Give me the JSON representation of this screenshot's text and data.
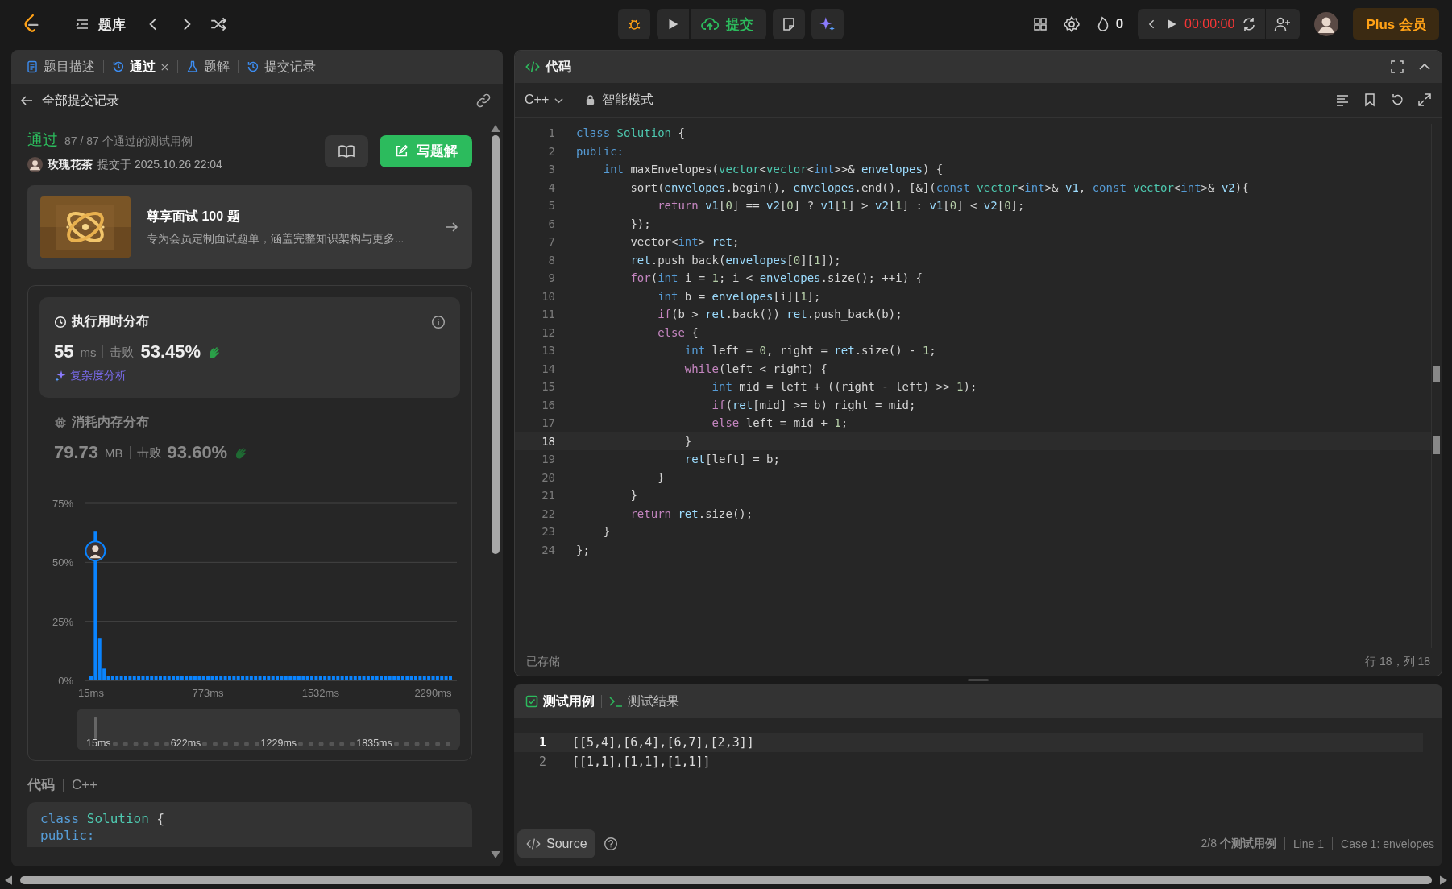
{
  "top_bar": {
    "problem_list": "题库",
    "submit": "提交",
    "streak": "0",
    "timer": "00:00:00",
    "plus": "Plus 会员"
  },
  "left_panel": {
    "tabs": [
      {
        "label": "题目描述",
        "kind": "description",
        "selected": false
      },
      {
        "label": "通过",
        "kind": "history",
        "selected": true,
        "closable": true
      },
      {
        "label": "题解",
        "kind": "solutions",
        "selected": false
      },
      {
        "label": "提交记录",
        "kind": "history",
        "selected": false
      }
    ],
    "back_label": "全部提交记录",
    "submission": {
      "status": "通过",
      "passed": "87 / 87 个通过的测试用例",
      "user": "玫瑰花茶",
      "submitted": "提交于 2025.10.26 22:04",
      "write_solution": "写题解"
    },
    "promo": {
      "title": "尊享面试 100 题",
      "subtitle": "专为会员定制面试题单，涵盖完整知识架构与更多..."
    },
    "runtime": {
      "title": "执行用时分布",
      "selected": true,
      "value": "55",
      "unit": "ms",
      "beats_label": "击败",
      "beats": "53.45%",
      "analysis": "复杂度分析"
    },
    "memory": {
      "title": "消耗内存分布",
      "selected": false,
      "value": "79.73",
      "unit": "MB",
      "beats_label": "击败",
      "beats": "93.60%"
    },
    "chart_data": {
      "type": "bar",
      "ylim": [
        0,
        75
      ],
      "yticks": [
        {
          "value": 0,
          "label": "0%"
        },
        {
          "value": 25,
          "label": "25%"
        },
        {
          "value": 50,
          "label": "50%"
        },
        {
          "value": 75,
          "label": "75%"
        }
      ],
      "categories": [
        "15ms",
        null,
        null,
        null,
        null,
        null,
        null,
        null,
        null,
        null,
        null,
        null,
        null,
        null,
        null,
        null,
        null,
        null,
        null,
        null,
        null,
        null,
        null,
        null,
        null,
        null,
        null,
        "773ms",
        null,
        null,
        null,
        null,
        null,
        null,
        null,
        null,
        null,
        null,
        null,
        null,
        null,
        null,
        null,
        null,
        null,
        null,
        null,
        null,
        null,
        null,
        null,
        null,
        null,
        "1532ms",
        null,
        null,
        null,
        null,
        null,
        null,
        null,
        null,
        null,
        null,
        null,
        null,
        null,
        null,
        null,
        null,
        null,
        null,
        null,
        null,
        null,
        null,
        null,
        null,
        null,
        "2290ms",
        null,
        null,
        null,
        null
      ],
      "series": [
        {
          "color": "#0a84ff",
          "values": [
            2,
            63,
            18,
            5,
            2,
            2,
            2,
            2,
            2,
            2,
            2,
            2,
            2,
            2,
            2,
            2,
            2,
            2,
            2,
            2,
            2,
            2,
            2,
            2,
            2,
            2,
            2,
            2,
            2,
            2,
            2,
            2,
            2,
            2,
            2,
            2,
            2,
            2,
            2,
            2,
            2,
            2,
            2,
            2,
            2,
            2,
            2,
            2,
            2,
            2,
            2,
            2,
            2,
            2,
            2,
            2,
            2,
            2,
            2,
            2,
            2,
            2,
            2,
            2,
            2,
            2,
            2,
            2,
            2,
            2,
            2,
            2,
            2,
            2,
            2,
            2,
            2,
            2,
            2,
            2,
            2,
            2,
            2,
            2
          ]
        }
      ]
    },
    "overview_labels": [
      "15ms",
      "622ms",
      "1229ms",
      "1835ms"
    ],
    "code_label": "代码",
    "code_language": "C++",
    "code_preview": [
      [
        {
          "text": "class",
          "kind": "keyword"
        },
        {
          "text": " Solution",
          "kind": "type"
        },
        {
          "text": " {",
          "kind": "plain"
        }
      ],
      [
        {
          "text": "public:",
          "kind": "keyword"
        }
      ]
    ]
  },
  "editor": {
    "title": "代码",
    "language": "C++",
    "mode": "智能模式",
    "saved": "已存储",
    "cursor": "行 18，列 18",
    "lines": [
      {
        "n": "1",
        "active": false,
        "tokens": [
          {
            "text": "class",
            "kind": "keyword"
          },
          {
            "text": " Solution",
            "kind": "type"
          },
          {
            "text": " {",
            "kind": "plain"
          }
        ]
      },
      {
        "n": "2",
        "active": false,
        "tokens": [
          {
            "text": "public:",
            "kind": "keyword"
          }
        ]
      },
      {
        "n": "3",
        "active": false,
        "tokens": [
          {
            "text": "    int",
            "kind": "keyword"
          },
          {
            "text": " maxEnvelopes(",
            "kind": "plain"
          },
          {
            "text": "vector",
            "kind": "type"
          },
          {
            "text": "<",
            "kind": "plain"
          },
          {
            "text": "vector",
            "kind": "type"
          },
          {
            "text": "<",
            "kind": "plain"
          },
          {
            "text": "int",
            "kind": "keyword"
          },
          {
            "text": ">>& ",
            "kind": "plain"
          },
          {
            "text": "envelopes",
            "kind": "variable"
          },
          {
            "text": ") {",
            "kind": "plain"
          }
        ]
      },
      {
        "n": "4",
        "active": false,
        "tokens": [
          {
            "text": "        sort(",
            "kind": "plain"
          },
          {
            "text": "envelopes",
            "kind": "variable"
          },
          {
            "text": ".begin(), ",
            "kind": "plain"
          },
          {
            "text": "envelopes",
            "kind": "variable"
          },
          {
            "text": ".end(), [&](",
            "kind": "plain"
          },
          {
            "text": "const",
            "kind": "keyword"
          },
          {
            "text": " vector",
            "kind": "type"
          },
          {
            "text": "<",
            "kind": "plain"
          },
          {
            "text": "int",
            "kind": "keyword"
          },
          {
            "text": ">& ",
            "kind": "plain"
          },
          {
            "text": "v1",
            "kind": "variable"
          },
          {
            "text": ", ",
            "kind": "plain"
          },
          {
            "text": "const",
            "kind": "keyword"
          },
          {
            "text": " vector",
            "kind": "type"
          },
          {
            "text": "<",
            "kind": "plain"
          },
          {
            "text": "int",
            "kind": "keyword"
          },
          {
            "text": ">& ",
            "kind": "plain"
          },
          {
            "text": "v2",
            "kind": "variable"
          },
          {
            "text": "){",
            "kind": "plain"
          }
        ]
      },
      {
        "n": "5",
        "active": false,
        "tokens": [
          {
            "text": "            return",
            "kind": "control"
          },
          {
            "text": " v1",
            "kind": "variable"
          },
          {
            "text": "[",
            "kind": "plain"
          },
          {
            "text": "0",
            "kind": "number"
          },
          {
            "text": "] == ",
            "kind": "plain"
          },
          {
            "text": "v2",
            "kind": "variable"
          },
          {
            "text": "[",
            "kind": "plain"
          },
          {
            "text": "0",
            "kind": "number"
          },
          {
            "text": "] ? ",
            "kind": "plain"
          },
          {
            "text": "v1",
            "kind": "variable"
          },
          {
            "text": "[",
            "kind": "plain"
          },
          {
            "text": "1",
            "kind": "number"
          },
          {
            "text": "] > ",
            "kind": "plain"
          },
          {
            "text": "v2",
            "kind": "variable"
          },
          {
            "text": "[",
            "kind": "plain"
          },
          {
            "text": "1",
            "kind": "number"
          },
          {
            "text": "] : ",
            "kind": "plain"
          },
          {
            "text": "v1",
            "kind": "variable"
          },
          {
            "text": "[",
            "kind": "plain"
          },
          {
            "text": "0",
            "kind": "number"
          },
          {
            "text": "] < ",
            "kind": "plain"
          },
          {
            "text": "v2",
            "kind": "variable"
          },
          {
            "text": "[",
            "kind": "plain"
          },
          {
            "text": "0",
            "kind": "number"
          },
          {
            "text": "];",
            "kind": "plain"
          }
        ]
      },
      {
        "n": "6",
        "active": false,
        "tokens": [
          {
            "text": "        });",
            "kind": "plain"
          }
        ]
      },
      {
        "n": "7",
        "active": false,
        "tokens": [
          {
            "text": "        vector<",
            "kind": "plain"
          },
          {
            "text": "int",
            "kind": "keyword"
          },
          {
            "text": "> ",
            "kind": "plain"
          },
          {
            "text": "ret",
            "kind": "variable"
          },
          {
            "text": ";",
            "kind": "plain"
          }
        ]
      },
      {
        "n": "8",
        "active": false,
        "tokens": [
          {
            "text": "        ret",
            "kind": "variable"
          },
          {
            "text": ".push_back(",
            "kind": "plain"
          },
          {
            "text": "envelopes",
            "kind": "variable"
          },
          {
            "text": "[",
            "kind": "plain"
          },
          {
            "text": "0",
            "kind": "number"
          },
          {
            "text": "][",
            "kind": "plain"
          },
          {
            "text": "1",
            "kind": "number"
          },
          {
            "text": "]);",
            "kind": "plain"
          }
        ]
      },
      {
        "n": "9",
        "active": false,
        "tokens": [
          {
            "text": "        for",
            "kind": "control"
          },
          {
            "text": "(",
            "kind": "plain"
          },
          {
            "text": "int",
            "kind": "keyword"
          },
          {
            "text": " i = ",
            "kind": "plain"
          },
          {
            "text": "1",
            "kind": "number"
          },
          {
            "text": "; i < ",
            "kind": "plain"
          },
          {
            "text": "envelopes",
            "kind": "variable"
          },
          {
            "text": ".size(); ++i) {",
            "kind": "plain"
          }
        ]
      },
      {
        "n": "10",
        "active": false,
        "tokens": [
          {
            "text": "            int",
            "kind": "keyword"
          },
          {
            "text": " b = ",
            "kind": "plain"
          },
          {
            "text": "envelopes",
            "kind": "variable"
          },
          {
            "text": "[i][",
            "kind": "plain"
          },
          {
            "text": "1",
            "kind": "number"
          },
          {
            "text": "];",
            "kind": "plain"
          }
        ]
      },
      {
        "n": "11",
        "active": false,
        "tokens": [
          {
            "text": "            if",
            "kind": "control"
          },
          {
            "text": "(b > ",
            "kind": "plain"
          },
          {
            "text": "ret",
            "kind": "variable"
          },
          {
            "text": ".back()) ",
            "kind": "plain"
          },
          {
            "text": "ret",
            "kind": "variable"
          },
          {
            "text": ".push_back(b);",
            "kind": "plain"
          }
        ]
      },
      {
        "n": "12",
        "active": false,
        "tokens": [
          {
            "text": "            else",
            "kind": "control"
          },
          {
            "text": " {",
            "kind": "plain"
          }
        ]
      },
      {
        "n": "13",
        "active": false,
        "tokens": [
          {
            "text": "                int",
            "kind": "keyword"
          },
          {
            "text": " left = ",
            "kind": "plain"
          },
          {
            "text": "0",
            "kind": "number"
          },
          {
            "text": ", right = ",
            "kind": "plain"
          },
          {
            "text": "ret",
            "kind": "variable"
          },
          {
            "text": ".size() - ",
            "kind": "plain"
          },
          {
            "text": "1",
            "kind": "number"
          },
          {
            "text": ";",
            "kind": "plain"
          }
        ]
      },
      {
        "n": "14",
        "active": false,
        "tokens": [
          {
            "text": "                while",
            "kind": "control"
          },
          {
            "text": "(left < right) {",
            "kind": "plain"
          }
        ]
      },
      {
        "n": "15",
        "active": false,
        "tokens": [
          {
            "text": "                    int",
            "kind": "keyword"
          },
          {
            "text": " mid = left + ((right - left) >> ",
            "kind": "plain"
          },
          {
            "text": "1",
            "kind": "number"
          },
          {
            "text": ");",
            "kind": "plain"
          }
        ]
      },
      {
        "n": "16",
        "active": false,
        "tokens": [
          {
            "text": "                    if",
            "kind": "control"
          },
          {
            "text": "(",
            "kind": "plain"
          },
          {
            "text": "ret",
            "kind": "variable"
          },
          {
            "text": "[mid] >= b) right = mid;",
            "kind": "plain"
          }
        ]
      },
      {
        "n": "17",
        "active": false,
        "tokens": [
          {
            "text": "                    else",
            "kind": "control"
          },
          {
            "text": " left = mid + ",
            "kind": "plain"
          },
          {
            "text": "1",
            "kind": "number"
          },
          {
            "text": ";",
            "kind": "plain"
          }
        ]
      },
      {
        "n": "18",
        "active": true,
        "tokens": [
          {
            "text": "                }",
            "kind": "plain"
          }
        ]
      },
      {
        "n": "19",
        "active": false,
        "tokens": [
          {
            "text": "                ret",
            "kind": "variable"
          },
          {
            "text": "[left] = b;",
            "kind": "plain"
          }
        ]
      },
      {
        "n": "20",
        "active": false,
        "tokens": [
          {
            "text": "            }",
            "kind": "plain"
          }
        ]
      },
      {
        "n": "21",
        "active": false,
        "tokens": [
          {
            "text": "        }",
            "kind": "plain"
          }
        ]
      },
      {
        "n": "22",
        "active": false,
        "tokens": [
          {
            "text": "        return",
            "kind": "control"
          },
          {
            "text": " ret",
            "kind": "variable"
          },
          {
            "text": ".size();",
            "kind": "plain"
          }
        ]
      },
      {
        "n": "23",
        "active": false,
        "tokens": [
          {
            "text": "    }",
            "kind": "plain"
          }
        ]
      },
      {
        "n": "24",
        "active": false,
        "tokens": [
          {
            "text": "};",
            "kind": "plain"
          }
        ]
      }
    ]
  },
  "tests": {
    "tabs": [
      {
        "label": "测试用例",
        "kind": "cases",
        "selected": true
      },
      {
        "label": "测试结果",
        "kind": "result",
        "selected": false
      }
    ],
    "lines": [
      {
        "n": "1",
        "text": "[[5,4],[6,4],[6,7],[2,3]]",
        "active": true
      },
      {
        "n": "2",
        "text": "[[1,1],[1,1],[1,1]]",
        "active": false
      }
    ],
    "source": "Source",
    "count": "2/8 **个测试用例**",
    "line": "Line 1",
    "case": "Case 1: envelopes"
  }
}
